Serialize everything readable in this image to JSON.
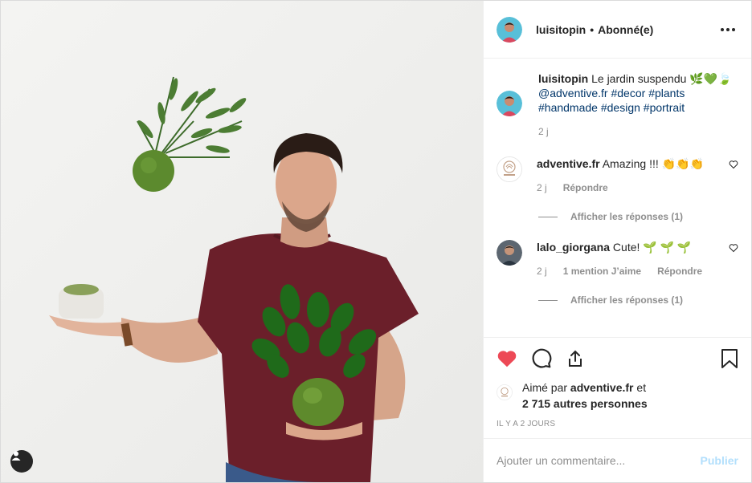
{
  "post": {
    "author": "luisitopin",
    "follow_status": "Abonné(e)",
    "separator": "•",
    "more_icon": "more-horizontal-icon"
  },
  "caption": {
    "username": "luisitopin",
    "text": "Le jardin suspendu 🌿💚🍃",
    "mention": "@adventive.fr",
    "hashtags": [
      "#decor",
      "#plants",
      "#handmade",
      "#design",
      "#portrait"
    ],
    "age": "2 j"
  },
  "comments": [
    {
      "username": "adventive.fr",
      "text": "Amazing !!! 👏👏👏",
      "age": "2 j",
      "likes": "",
      "reply_label": "Répondre",
      "view_replies": "Afficher les réponses (1)"
    },
    {
      "username": "lalo_giorgana",
      "text": "Cute! 🌱 🌱 🌱",
      "age": "2 j",
      "likes": "1 mention J’aime",
      "reply_label": "Répondre",
      "view_replies": "Afficher les réponses (1)"
    }
  ],
  "likes": {
    "prefix": "Aimé par",
    "first_user": "adventive.fr",
    "conjunction": "et",
    "others": "2 715 autres personnes"
  },
  "timestamp": "IL Y A 2 JOURS",
  "add_comment": {
    "placeholder": "Ajouter un commentaire...",
    "post_label": "Publier"
  },
  "colors": {
    "like_red": "#ed4956",
    "link_blue": "#003569",
    "publish_disabled": "#b2dffc",
    "shirt": "#6b1f2a"
  }
}
